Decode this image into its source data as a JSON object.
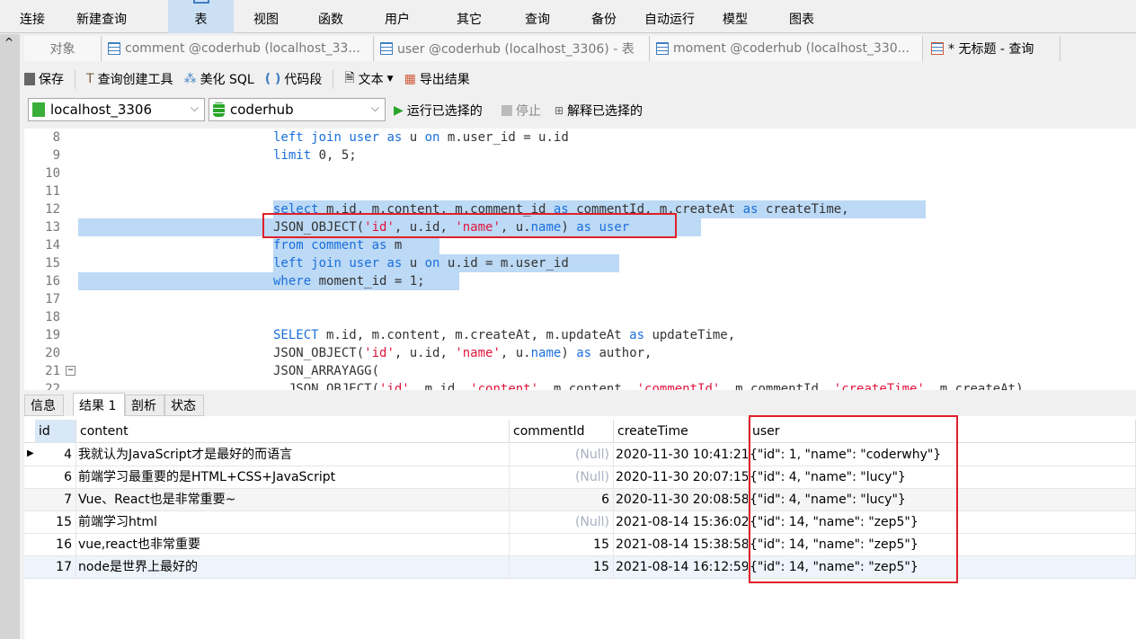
{
  "ribbon": {
    "items": [
      {
        "label": "连接"
      },
      {
        "label": "新建查询"
      },
      {
        "label": "表"
      },
      {
        "label": "视图"
      },
      {
        "label": "函数"
      },
      {
        "label": "用户"
      },
      {
        "label": "其它"
      },
      {
        "label": "查询"
      },
      {
        "label": "备份"
      },
      {
        "label": "自动运行"
      },
      {
        "label": "模型"
      },
      {
        "label": "图表"
      }
    ],
    "active": "表"
  },
  "tabs": [
    {
      "label": "对象"
    },
    {
      "label": "comment @coderhub (localhost_33..."
    },
    {
      "label": "user @coderhub (localhost_3306) - 表"
    },
    {
      "label": "moment @coderhub (localhost_330..."
    },
    {
      "label": "* 无标题 - 查询"
    }
  ],
  "toolbar": {
    "save": "保存",
    "query_builder": "查询创建工具",
    "beautify": "美化 SQL",
    "snippet": "代码段",
    "text": "文本",
    "export": "导出结果"
  },
  "connection": {
    "server": "localhost_3306",
    "database": "coderhub",
    "run_selected": "运行已选择的",
    "stop": "停止",
    "explain_selected": "解释已选择的"
  },
  "editor": {
    "lines": [
      {
        "n": "8",
        "text": "left join user as u on m.user_id = u.id"
      },
      {
        "n": "9",
        "text": "limit 0, 5;"
      },
      {
        "n": "10",
        "text": ""
      },
      {
        "n": "11",
        "text": ""
      },
      {
        "n": "12",
        "text": "select m.id, m.content, m.comment_id as commentId, m.createAt as createTime,"
      },
      {
        "n": "13",
        "text": "JSON_OBJECT('id', u.id, 'name', u.name) as user"
      },
      {
        "n": "14",
        "text": "from comment as m"
      },
      {
        "n": "15",
        "text": "left join user as u on u.id = m.user_id"
      },
      {
        "n": "16",
        "text": "where moment_id = 1;"
      },
      {
        "n": "17",
        "text": ""
      },
      {
        "n": "18",
        "text": ""
      },
      {
        "n": "19",
        "text": "SELECT m.id, m.content, m.createAt, m.updateAt as updateTime,"
      },
      {
        "n": "20",
        "text": "JSON_OBJECT('id', u.id, 'name', u.name) as author,"
      },
      {
        "n": "21",
        "text": "JSON_ARRAYAGG("
      },
      {
        "n": "22",
        "text": "  JSON_OBJECT('id', m.id, 'content', m.content, 'commentId', m.commentId, 'createTime', m.createAt)"
      }
    ]
  },
  "result_tabs": [
    {
      "label": "信息"
    },
    {
      "label": "结果 1"
    },
    {
      "label": "剖析"
    },
    {
      "label": "状态"
    }
  ],
  "results": {
    "columns": [
      "id",
      "content",
      "commentId",
      "createTime",
      "user"
    ],
    "rows": [
      [
        "4",
        "我就认为JavaScript才是最好的而语言",
        "(Null)",
        "2020-11-30 10:41:21",
        "{\"id\": 1, \"name\": \"coderwhy\"}"
      ],
      [
        "6",
        "前端学习最重要的是HTML+CSS+JavaScript",
        "(Null)",
        "2020-11-30 20:07:15",
        "{\"id\": 4, \"name\": \"lucy\"}"
      ],
      [
        "7",
        "Vue、React也是非常重要~",
        "6",
        "2020-11-30 20:08:58",
        "{\"id\": 4, \"name\": \"lucy\"}"
      ],
      [
        "15",
        "前端学习html",
        "(Null)",
        "2021-08-14 15:36:02",
        "{\"id\": 14, \"name\": \"zep5\"}"
      ],
      [
        "16",
        "vue,react也非常重要",
        "15",
        "2021-08-14 15:38:58",
        "{\"id\": 14, \"name\": \"zep5\"}"
      ],
      [
        "17",
        "node是世界上最好的",
        "15",
        "2021-08-14 16:12:59",
        "{\"id\": 14, \"name\": \"zep5\"}"
      ]
    ]
  },
  "colors": {
    "keyword": "#1a6fdc",
    "string": "#e0143c",
    "number": "#17b34a",
    "selection": "#bcd9f5",
    "highlight_box": "#e0202a"
  }
}
